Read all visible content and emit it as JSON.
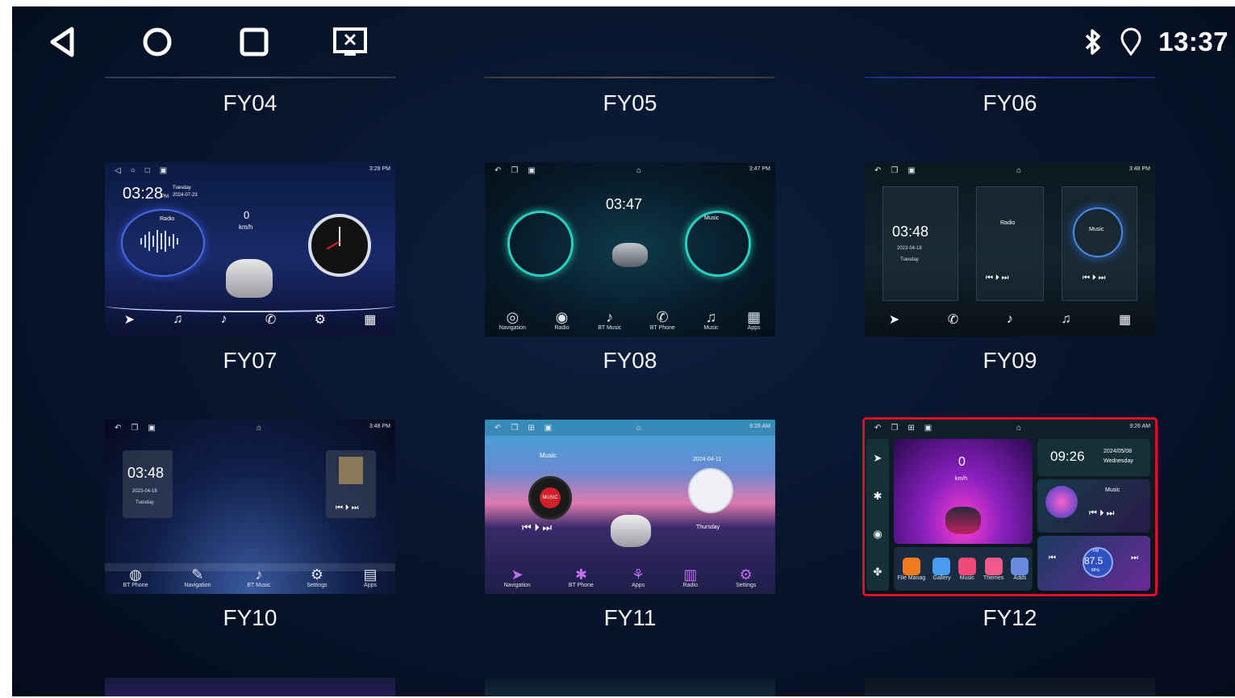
{
  "system_bar": {
    "back_icon": "back-triangle-icon",
    "home_icon": "home-circle-icon",
    "recents_icon": "recents-square-icon",
    "screen_off_icon": "screen-off-icon",
    "bluetooth_icon": "bluetooth-icon",
    "location_icon": "location-pin-icon",
    "time": "13:37"
  },
  "top_row_labels": [
    "FY04",
    "FY05",
    "FY06"
  ],
  "themes": [
    {
      "label": "FY07",
      "status_time": "3:28 PM",
      "clock": "03:28",
      "clock_suffix": "PM",
      "day": "Tuesday",
      "date": "2024-07-23",
      "widget": "Radio",
      "speed": "0",
      "speed_unit": "km/h"
    },
    {
      "label": "FY08",
      "status_time": "3:47 PM",
      "clock": "03:47",
      "widget": "Music",
      "dock": [
        "Navigation",
        "Radio",
        "BT Music",
        "BT Phone",
        "Music",
        "Apps"
      ]
    },
    {
      "label": "FY09",
      "status_time": "3:48 PM",
      "clock": "03:48",
      "date": "2023-04-18",
      "day": "Tuesday",
      "widget_a": "Radio",
      "widget_b": "Music"
    },
    {
      "label": "FY10",
      "status_time": "3:48 PM",
      "clock": "03:48",
      "date": "2023-04-18",
      "day": "Tuesday",
      "dock": [
        "BT Phone",
        "Navigation",
        "BT Music",
        "Settings",
        "Apps"
      ]
    },
    {
      "label": "FY11",
      "status_time": "6:26 AM",
      "widget": "Music",
      "disc_text": "MUSIC",
      "date": "2024-04-11",
      "day": "Thursday",
      "dock": [
        "Navigation",
        "BT Phone",
        "Apps",
        "Radio",
        "Settings"
      ]
    },
    {
      "label": "FY12",
      "status_time": "9:26 AM",
      "speed": "0",
      "speed_unit": "km/h",
      "clock": "09:26",
      "date": "2024/05/08",
      "day": "Wednesday",
      "widget": "Music",
      "radio_band": "FM",
      "radio_freq": "87.5",
      "radio_unit": "MHz",
      "apps": [
        "File Manag",
        "Gallery",
        "Music",
        "Themes",
        "Adds"
      ]
    }
  ],
  "colors": {
    "selection": "#e0102a",
    "background": "#07142a",
    "label": "#f2f4f8"
  }
}
